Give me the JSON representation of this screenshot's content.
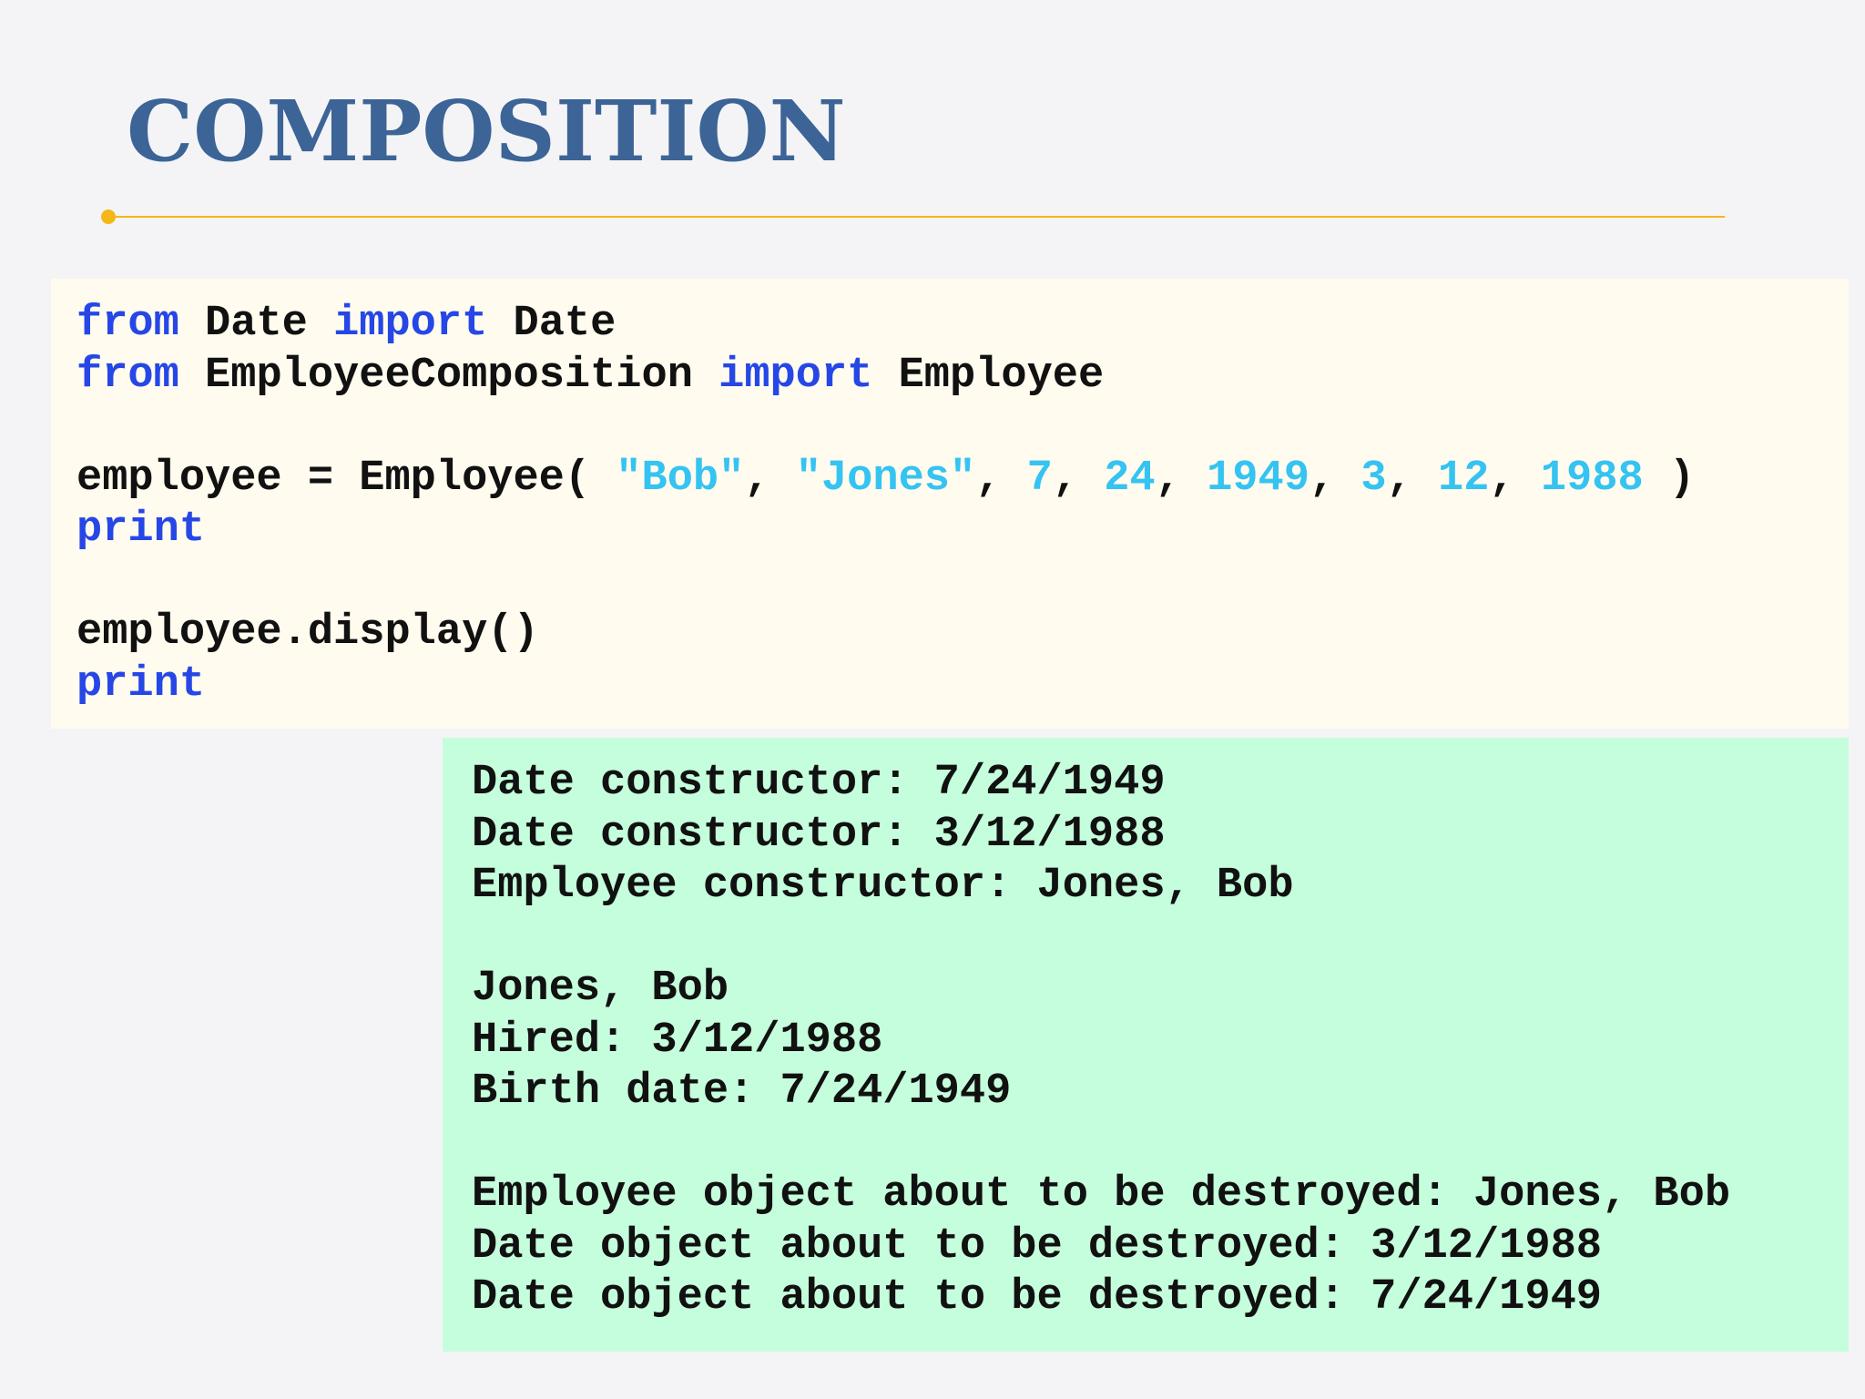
{
  "slide": {
    "title": "COMPOSITION"
  },
  "code": {
    "line1": {
      "kw1": "from",
      "mod": " Date ",
      "kw2": "import",
      "name": " Date"
    },
    "line2": {
      "kw1": "from",
      "mod": " EmployeeComposition ",
      "kw2": "import",
      "name": " Employee"
    },
    "line4": {
      "prefix": "employee = Employee( ",
      "arg1": "\"Bob\"",
      "sep1": ", ",
      "arg2": "\"Jones\"",
      "sep2": ", ",
      "arg3": "7",
      "sep3": ", ",
      "arg4": "24",
      "sep4": ", ",
      "arg5": "1949",
      "sep5": ", ",
      "arg6": "3",
      "sep6": ", ",
      "arg7": "12",
      "sep7": ", ",
      "arg8": "1988",
      "suffix": " )"
    },
    "line5": "print",
    "line7": "employee.display()",
    "line8": "print"
  },
  "output": {
    "lines": [
      "Date constructor: 7/24/1949",
      "Date constructor: 3/12/1988",
      "Employee constructor: Jones, Bob",
      "",
      "Jones, Bob",
      "Hired: 3/12/1988",
      "Birth date: 7/24/1949",
      "",
      "Employee object about to be destroyed: Jones, Bob",
      "Date object about to be destroyed: 3/12/1988",
      "Date object about to be destroyed: 7/24/1949"
    ]
  },
  "colors": {
    "title": "#3c6496",
    "accent_rule": "#f5b617",
    "keyword": "#2647e6",
    "literal": "#35c3f2",
    "code_background": "#fffbee",
    "output_background": "#c5fedc"
  }
}
